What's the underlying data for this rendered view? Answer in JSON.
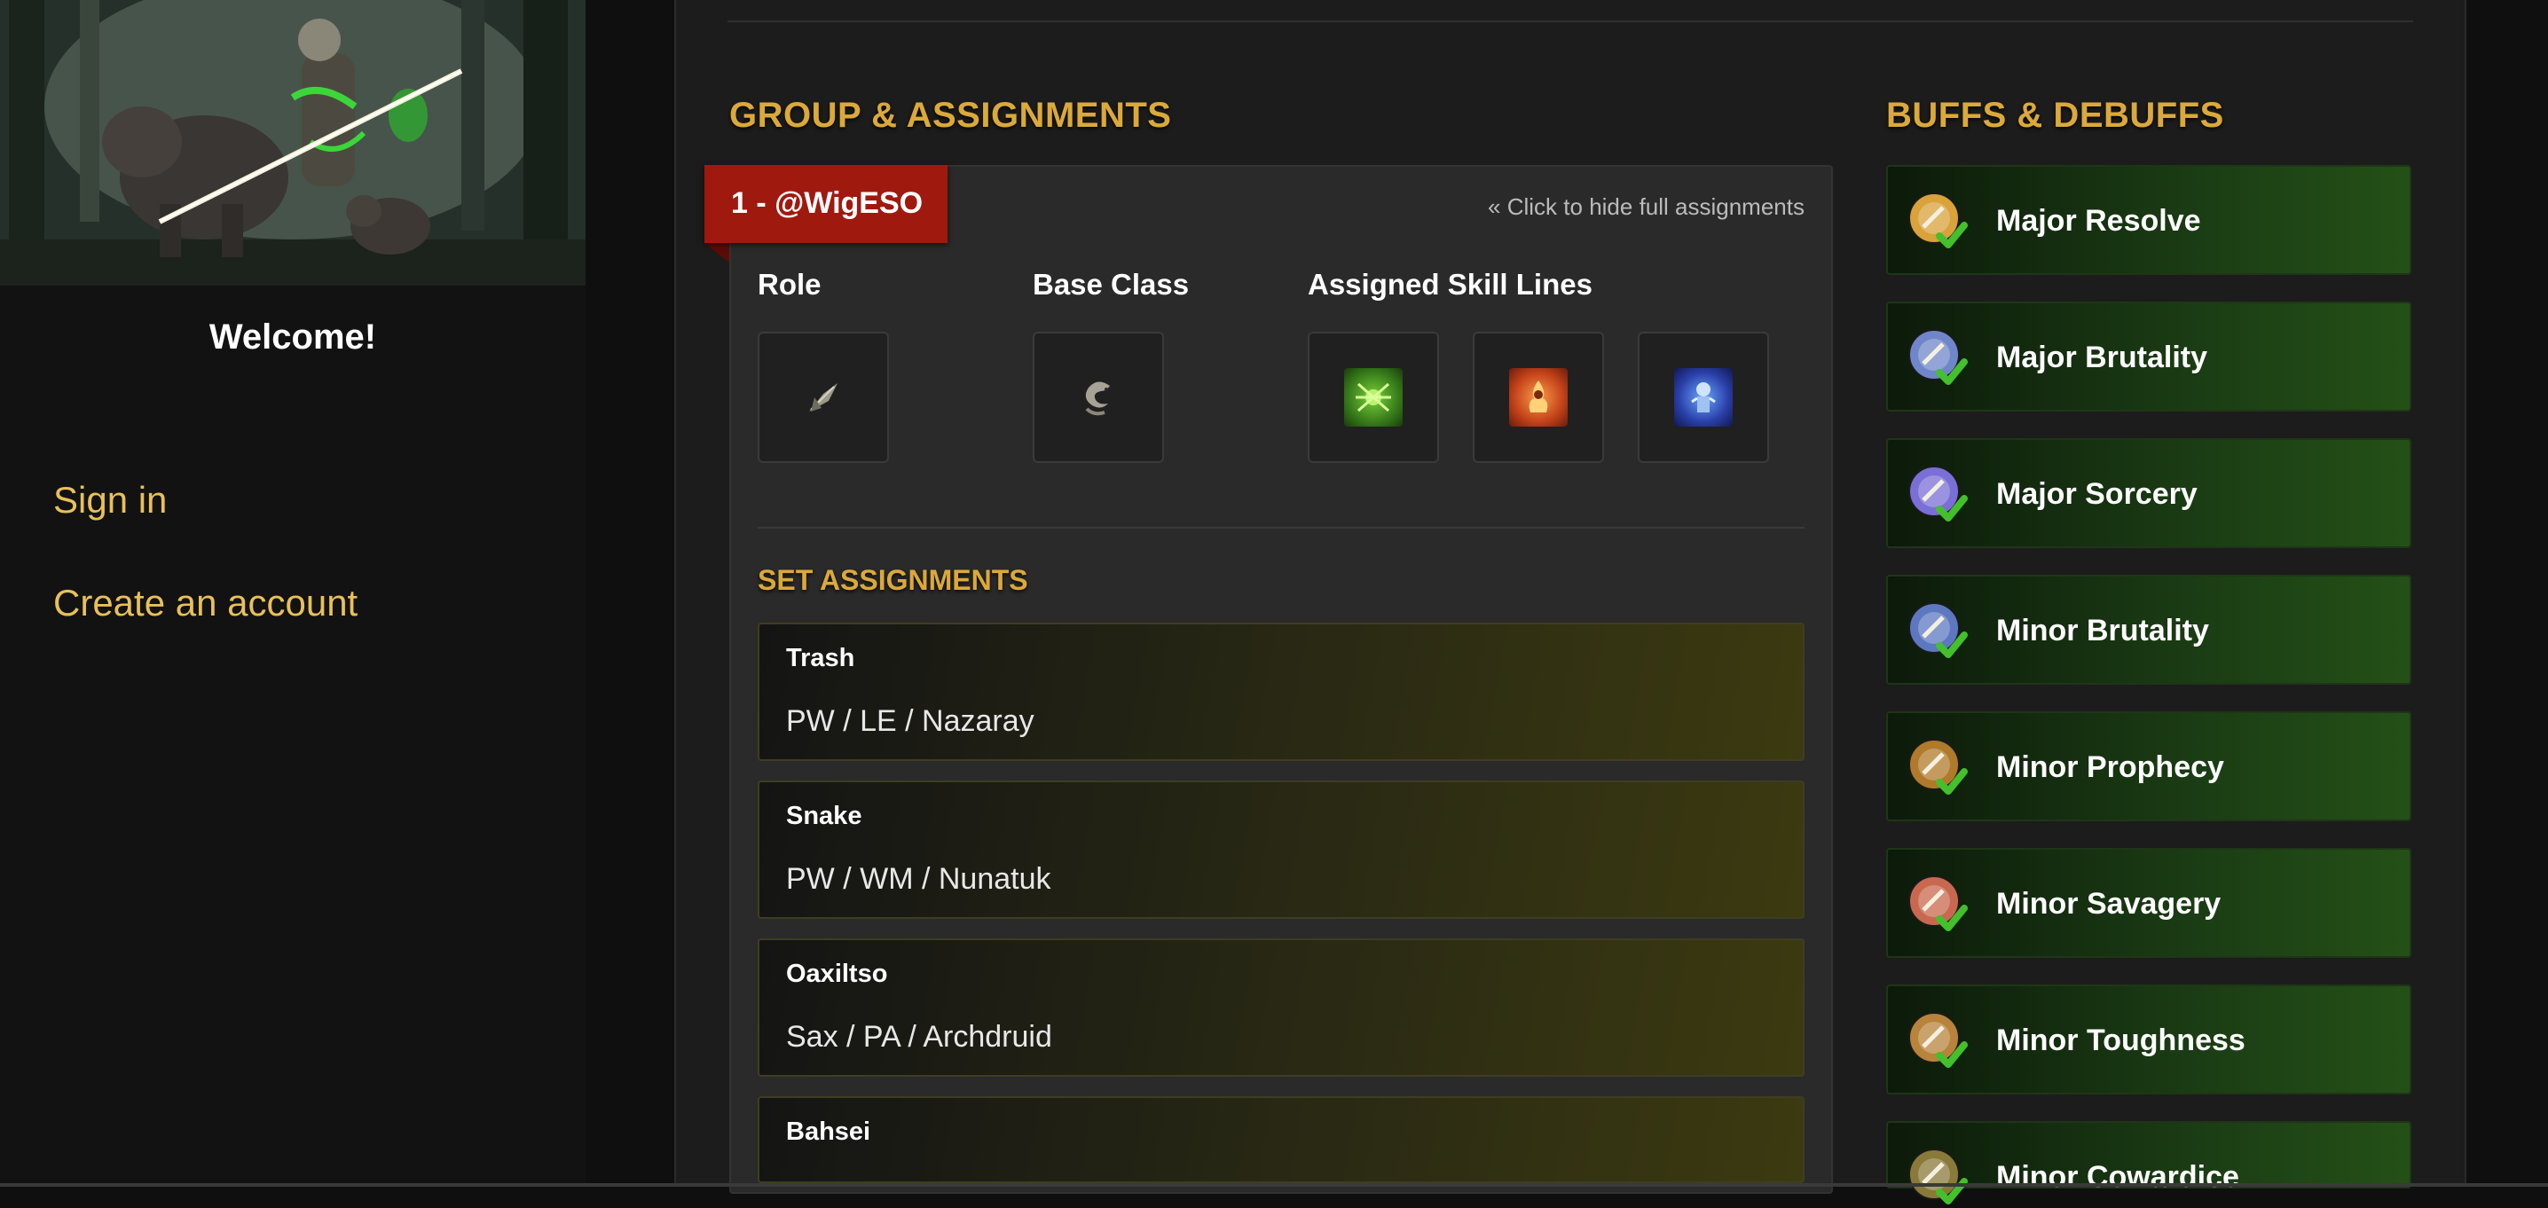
{
  "sidebar": {
    "welcome": "Welcome!",
    "links": [
      {
        "label": "Sign in"
      },
      {
        "label": "Create an account"
      }
    ]
  },
  "group_section": {
    "title": "GROUP & ASSIGNMENTS",
    "player_tag": "1 - @WigESO",
    "toggle_link": "« Click to hide full assignments",
    "role_label": "Role",
    "base_class_label": "Base Class",
    "skill_lines_label": "Assigned Skill Lines",
    "role_icon": "leaf-shield-icon",
    "class_icon": "dragon-icon",
    "skill_line_icons": [
      "green-spider-icon",
      "fire-atronach-icon",
      "frost-skeleton-icon"
    ]
  },
  "set_assignments": {
    "title": "SET ASSIGNMENTS",
    "items": [
      {
        "name": "Trash",
        "value": "PW / LE / Nazaray"
      },
      {
        "name": "Snake",
        "value": "PW / WM / Nunatuk"
      },
      {
        "name": "Oaxiltso",
        "value": "Sax / PA / Archdruid"
      },
      {
        "name": "Bahsei",
        "value": ""
      }
    ]
  },
  "buffs_section": {
    "title": "BUFFS & DEBUFFS",
    "items": [
      {
        "label": "Major Resolve",
        "icon": "shield-buff-icon",
        "color": "#d9a23a"
      },
      {
        "label": "Major Brutality",
        "icon": "axe-buff-icon",
        "color": "#6f86c9"
      },
      {
        "label": "Major Sorcery",
        "icon": "sorcery-buff-icon",
        "color": "#7a6fd6"
      },
      {
        "label": "Minor Brutality",
        "icon": "axe-buff-icon",
        "color": "#5d78c0"
      },
      {
        "label": "Minor Prophecy",
        "icon": "prophecy-buff-icon",
        "color": "#b07a2a"
      },
      {
        "label": "Minor Savagery",
        "icon": "savagery-buff-icon",
        "color": "#c8694f"
      },
      {
        "label": "Minor Toughness",
        "icon": "toughness-buff-icon",
        "color": "#b8833a"
      },
      {
        "label": "Minor Cowardice",
        "icon": "cowardice-debuff-icon",
        "color": "#8a7a3a"
      }
    ]
  },
  "colors": {
    "accent_gold": "#dba93a",
    "link_gold": "#e8c05a",
    "ribbon_red": "#a0190f",
    "buff_green": "#245017"
  }
}
